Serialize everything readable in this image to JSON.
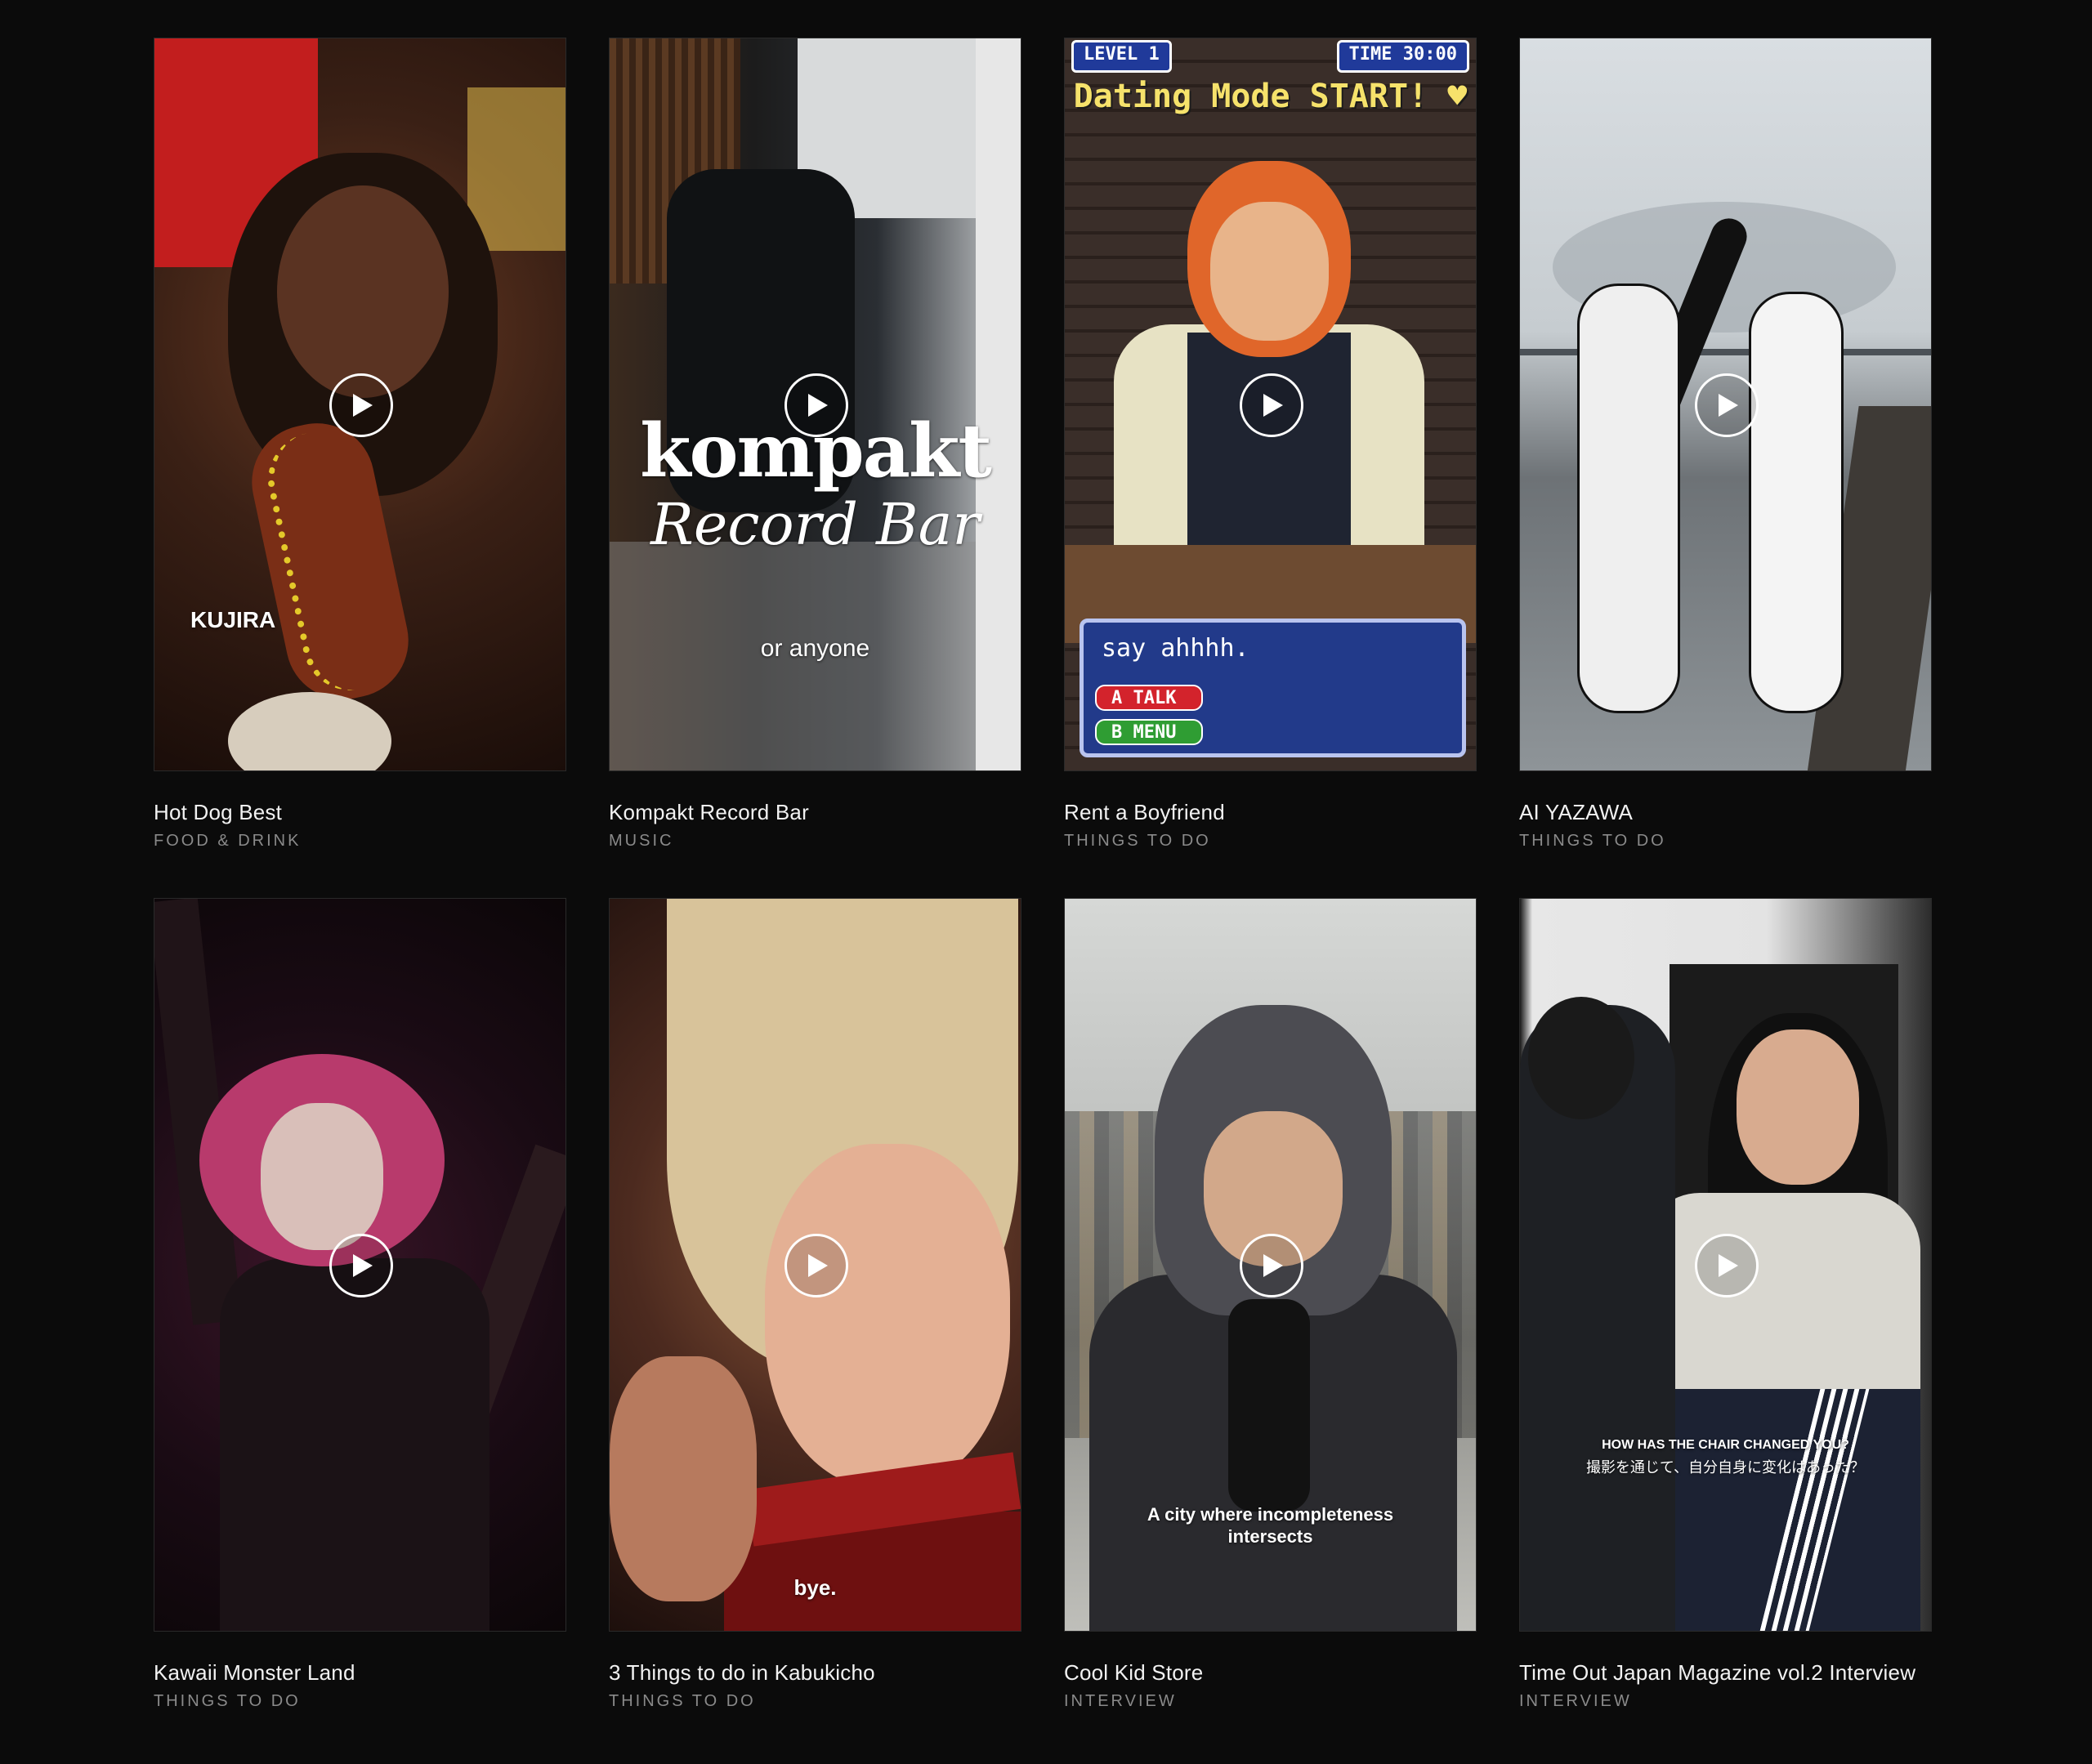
{
  "grid": {
    "cards": [
      {
        "title": "Hot Dog Best",
        "category": "FOOD & DRINK",
        "overlay_text": "KUJIRA"
      },
      {
        "title": "Kompakt Record Bar",
        "category": "MUSIC",
        "overlay_word": "kompakt",
        "overlay_sub": "Record Bar",
        "overlay_caption": "or anyone"
      },
      {
        "title": "Rent a Boyfriend",
        "category": "THINGS TO DO",
        "level_badge": "LEVEL 1",
        "time_badge": "TIME 30:00",
        "game_title": "Dating Mode START! ♥",
        "dialog_text": "say ahhhh.",
        "option_a": "A TALK",
        "option_b": "B MENU"
      },
      {
        "title": "AI YAZAWA",
        "category": "THINGS TO DO"
      },
      {
        "title": "Kawaii Monster Land",
        "category": "THINGS TO DO"
      },
      {
        "title": "3 Things to do in Kabukicho",
        "category": "THINGS TO DO",
        "overlay_caption": "bye."
      },
      {
        "title": "Cool Kid Store",
        "category": "INTERVIEW",
        "overlay_caption": "A city where incompleteness intersects"
      },
      {
        "title": "Time Out Japan Magazine vol.2 Interview",
        "category": "INTERVIEW",
        "overlay_caption_en": "HOW HAS THE CHAIR CHANGED YOU?",
        "overlay_caption_jp": "撮影を通じて、自分自身に変化はあった？"
      }
    ]
  },
  "icons": {
    "play": "play-circle-icon"
  },
  "colors": {
    "background": "#0b0b0b",
    "title": "#f2f2f2",
    "category": "#8a8a8a"
  }
}
